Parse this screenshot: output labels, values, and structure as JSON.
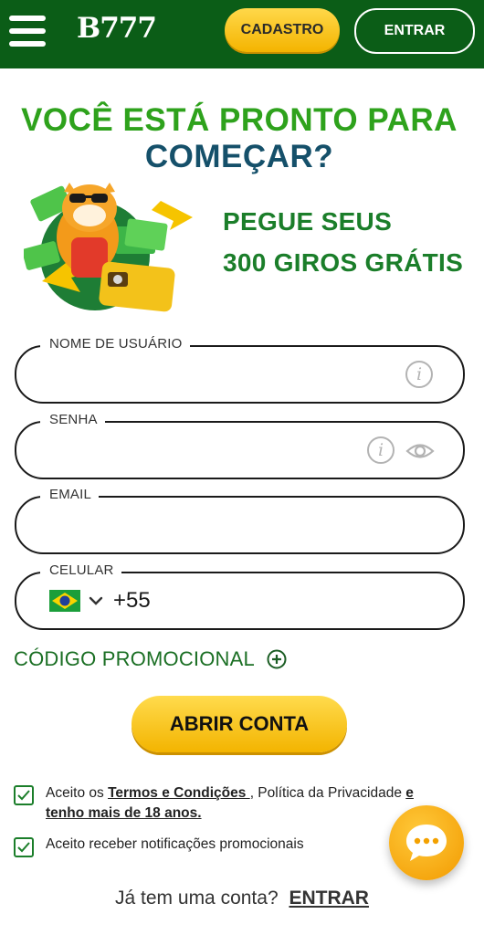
{
  "header": {
    "logo": "B777",
    "signup_label": "CADASTRO",
    "login_label": "ENTRAR"
  },
  "hero": {
    "title_line1": "VOCÊ ESTÁ PRONTO PARA",
    "title_line2": "COMEÇAR?",
    "offer_line1": "PEGUE SEUS",
    "offer_line2": "300 GIROS GRÁTIS"
  },
  "form": {
    "username_label": "NOME DE USUÁRIO",
    "password_label": "SENHA",
    "email_label": "EMAIL",
    "phone_label": "CELULAR",
    "phone_country_code": "+55",
    "promo_label": "CÓDIGO PROMOCIONAL",
    "submit_label": "ABRIR CONTA"
  },
  "checkboxes": {
    "terms_prefix": "Aceito os ",
    "terms_link": "Termos e Condições ",
    "terms_middle": ", Política da Privacidade ",
    "terms_link2": "e",
    "terms_line2": "tenho mais de 18 anos.",
    "notifications": "Aceito receber notificações promocionais"
  },
  "footer": {
    "has_account": "Já tem uma conta?",
    "login_link": "ENTRAR"
  },
  "colors": {
    "header_bg": "#0b5d17",
    "accent_yellow": "#f4b400",
    "green_text": "#2ea21c",
    "teal_text": "#15506a"
  }
}
